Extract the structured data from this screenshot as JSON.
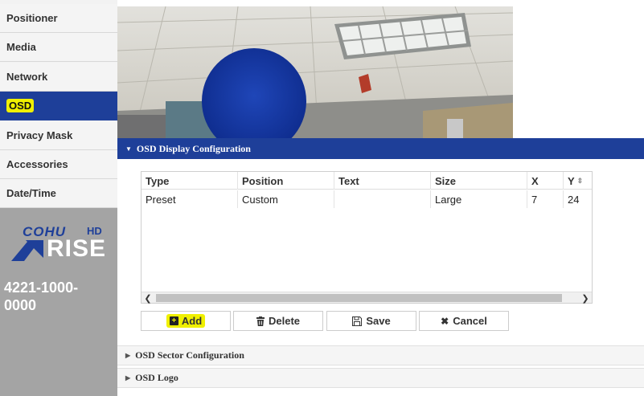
{
  "sidebar": {
    "items": [
      {
        "label": "Positioner"
      },
      {
        "label": "Media"
      },
      {
        "label": "Network"
      },
      {
        "label": "OSD"
      },
      {
        "label": "Privacy Mask"
      },
      {
        "label": "Accessories"
      },
      {
        "label": "Date/Time"
      }
    ],
    "active_item": "OSD"
  },
  "brand": {
    "logo_top": "COHU",
    "logo_hd": "HD",
    "logo_bottom": "RISE",
    "model": "4221-1000-0000"
  },
  "colors": {
    "accent": "#1e3f99",
    "highlight": "#f0f000",
    "sidebar_bg": "#a4a4a4"
  },
  "sections": {
    "osd_display": {
      "title": "OSD Display Configuration",
      "expanded": true
    },
    "osd_sector": {
      "title": "OSD Sector Configuration",
      "expanded": false
    },
    "osd_logo": {
      "title": "OSD Logo",
      "expanded": false
    }
  },
  "table": {
    "columns": [
      "Type",
      "Position",
      "Text",
      "Size",
      "X",
      "Y"
    ],
    "rows": [
      [
        "Preset",
        "Custom",
        "",
        "Large",
        "7",
        "24"
      ]
    ]
  },
  "buttons": {
    "add": "Add",
    "delete": "Delete",
    "save": "Save",
    "cancel": "Cancel"
  },
  "icons": {
    "section_expanded": "caret-down-icon",
    "section_collapsed": "caret-right-icon",
    "add": "plus-square-icon",
    "delete": "trash-icon",
    "save": "floppy-disk-icon",
    "cancel": "x-icon"
  }
}
